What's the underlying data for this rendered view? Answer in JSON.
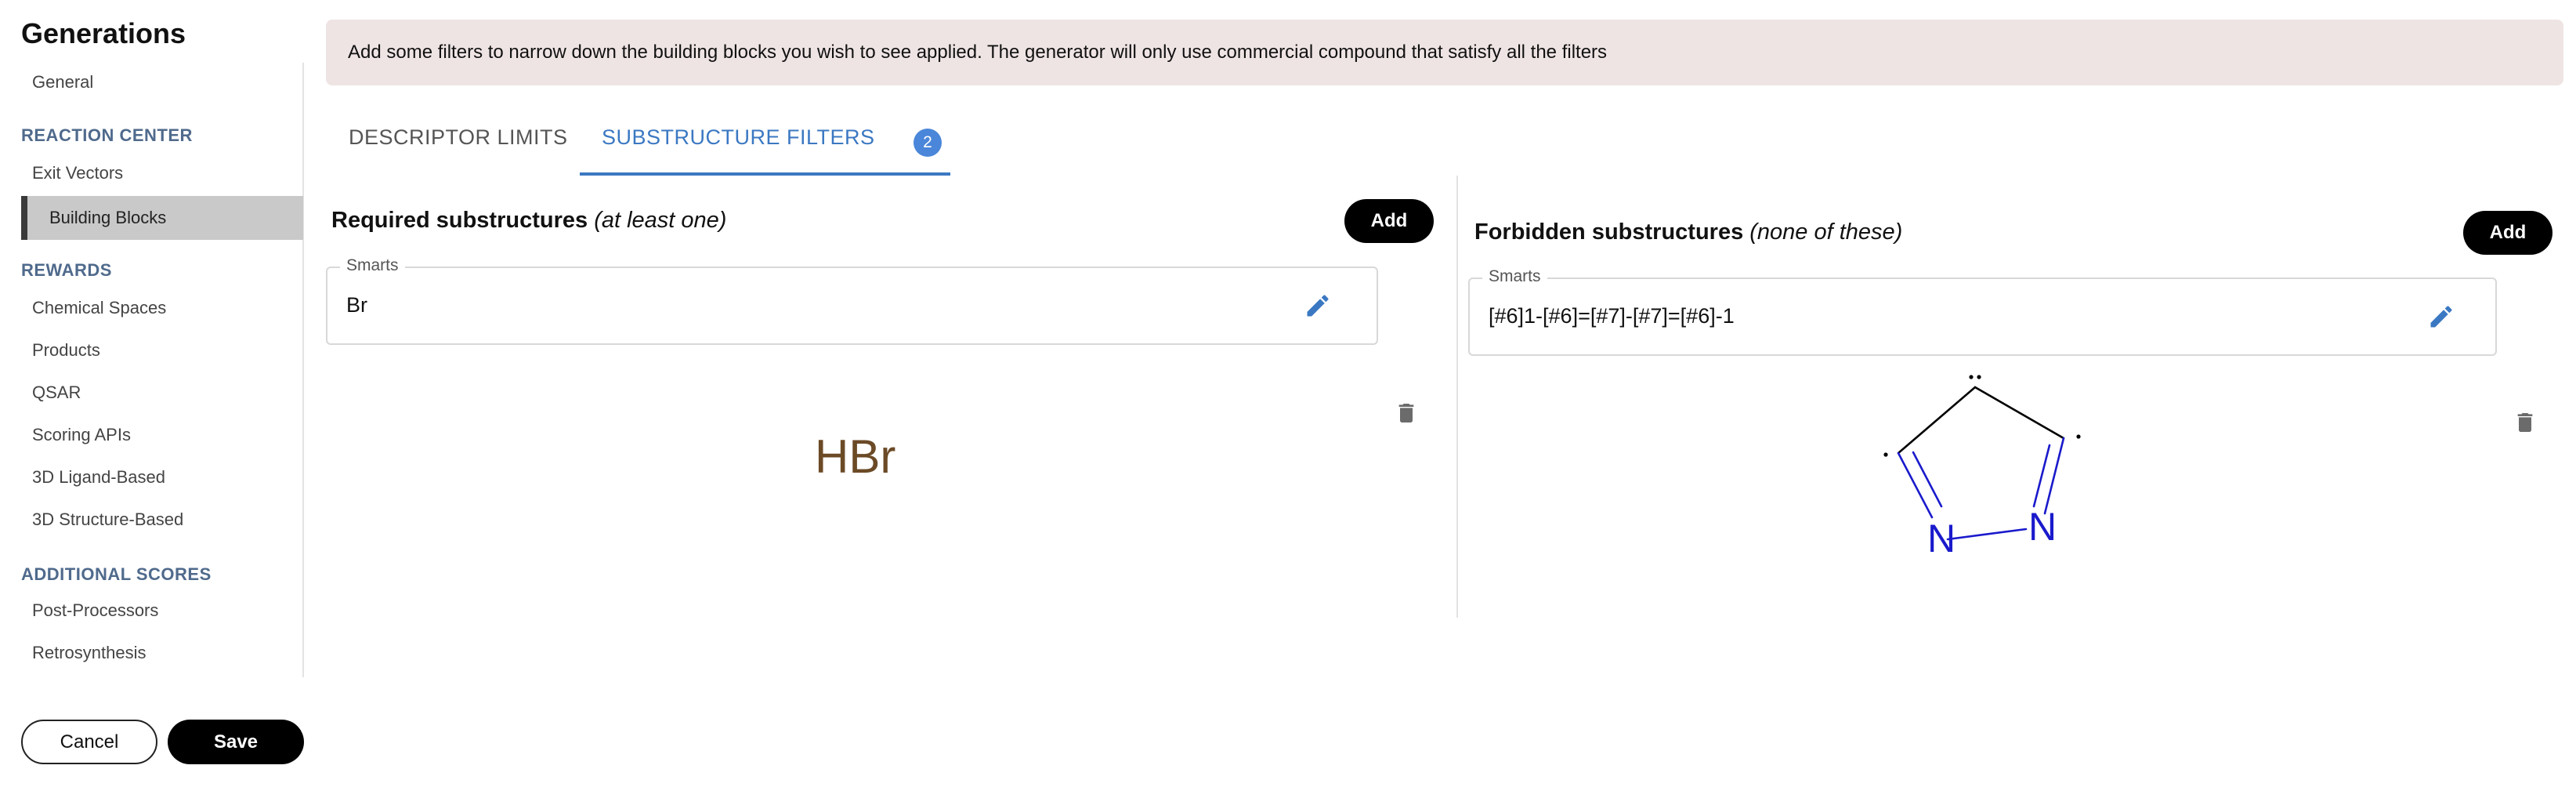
{
  "app": {
    "title": "Generations"
  },
  "sidebar": {
    "general": "General",
    "sections": [
      {
        "heading": "REACTION CENTER",
        "items": [
          "Exit Vectors",
          "Building Blocks"
        ]
      },
      {
        "heading": "REWARDS",
        "items": [
          "Chemical Spaces",
          "Products",
          "QSAR",
          "Scoring APIs",
          "3D Ligand-Based",
          "3D Structure-Based"
        ]
      },
      {
        "heading": "ADDITIONAL SCORES",
        "items": [
          "Post-Processors",
          "Retrosynthesis"
        ]
      }
    ],
    "active_item": "Building Blocks"
  },
  "footer": {
    "cancel_label": "Cancel",
    "save_label": "Save"
  },
  "banner": {
    "text": "Add some filters to narrow down the building blocks you wish to see applied. The generator will only use commercial compound that satisfy all the filters"
  },
  "tabs": [
    {
      "label": "DESCRIPTOR LIMITS",
      "active": false
    },
    {
      "label": "SUBSTRUCTURE FILTERS",
      "active": true,
      "badge": "2"
    }
  ],
  "required": {
    "title": "Required substructures",
    "hint": "(at least one)",
    "add_label": "Add",
    "field_label": "Smarts",
    "smarts": "Br",
    "molecule_label": "HBr"
  },
  "forbidden": {
    "title": "Forbidden substructures",
    "hint": "(none of these)",
    "add_label": "Add",
    "field_label": "Smarts",
    "smarts": "[#6]1-[#6]=[#7]-[#7]=[#6]-1",
    "atoms": [
      "N",
      "N"
    ]
  },
  "colors": {
    "accent": "#3b78c2",
    "badge": "#4a86d9",
    "banner_bg": "#efe4e4",
    "section_heading": "#4f6a8c",
    "nitrogen": "#1a1acc",
    "bromine_label": "#6b4a26"
  },
  "icons": {
    "edit": "pencil-icon",
    "delete": "trash-icon"
  }
}
